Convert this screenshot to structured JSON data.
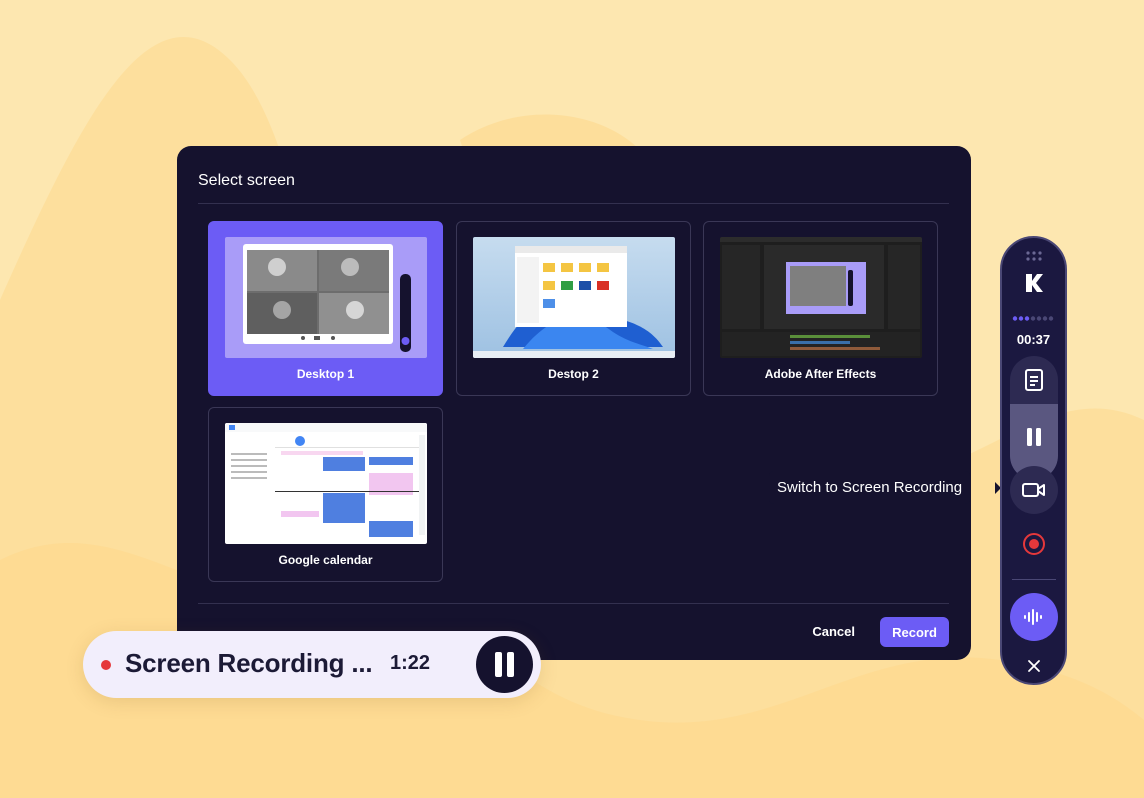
{
  "dialog": {
    "title": "Select screen",
    "screens": [
      {
        "label": "Desktop 1",
        "selected": true
      },
      {
        "label": "Destop 2",
        "selected": false
      },
      {
        "label": "Adobe After Effects",
        "selected": false
      },
      {
        "label": "Google calendar",
        "selected": false
      }
    ],
    "cancel_label": "Cancel",
    "record_label": "Record"
  },
  "recording_pill": {
    "status_text": "Screen Recording ...",
    "elapsed": "1:22"
  },
  "toolbar": {
    "brand_icon": "kapwing-k-logo-icon",
    "elapsed": "00:37",
    "tooltip": "Switch to Screen Recording"
  },
  "colors": {
    "accent": "#6c5cf5",
    "dialog_bg": "#15122e",
    "page_bg": "#fde7b0",
    "record_red": "#e5383b"
  }
}
